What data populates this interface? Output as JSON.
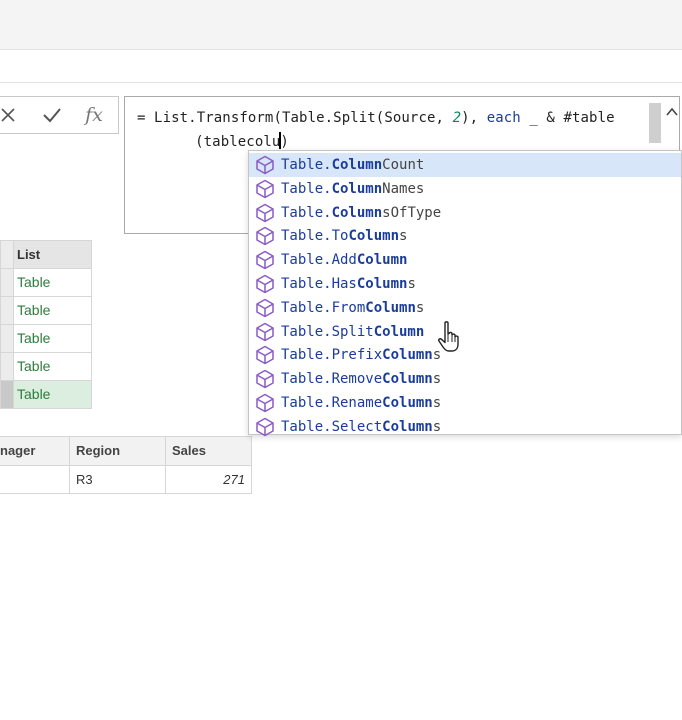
{
  "formula_bar": {
    "buttons": [
      {
        "name": "cancel",
        "icon": "close-icon"
      },
      {
        "name": "commit",
        "icon": "check-icon"
      },
      {
        "name": "insert-function",
        "label": "fx"
      }
    ],
    "line1_prefix": "= List.Transform(Table.Split(Source, ",
    "line1_num": "2",
    "line1_mid": "), ",
    "line1_kw": "each",
    "line1_suffix": " _ & #table",
    "line2_before_caret": "(tablecolu",
    "line2_after_caret": ")"
  },
  "list_grid": {
    "header": "List",
    "rows": [
      "Table",
      "Table",
      "Table",
      "Table",
      "Table"
    ],
    "selected_row": 4
  },
  "detail_table": {
    "headers": [
      "nager",
      "Region",
      "Sales"
    ],
    "rows": [
      [
        "",
        "R3",
        "271"
      ]
    ]
  },
  "autocomplete": {
    "prefix": "Table.",
    "items": [
      {
        "pre": "Table.",
        "parts": [
          [
            "",
            "Column",
            "Count"
          ]
        ]
      },
      {
        "pre": "Table.",
        "parts": [
          [
            "",
            "Column",
            "Names"
          ]
        ]
      },
      {
        "pre": "Table.",
        "parts": [
          [
            "",
            "Column",
            "sOfType"
          ]
        ]
      },
      {
        "pre": "Table.",
        "parts": [
          [
            "To",
            "Column",
            "s"
          ]
        ]
      },
      {
        "pre": "Table.",
        "parts": [
          [
            "Add",
            "Column",
            ""
          ]
        ]
      },
      {
        "pre": "Table.",
        "parts": [
          [
            "Has",
            "Column",
            "s"
          ]
        ]
      },
      {
        "pre": "Table.",
        "parts": [
          [
            "From",
            "Column",
            "s"
          ]
        ]
      },
      {
        "pre": "Table.",
        "parts": [
          [
            "Split",
            "Column",
            ""
          ]
        ]
      },
      {
        "pre": "Table.",
        "parts": [
          [
            "Prefix",
            "Column",
            "s"
          ]
        ]
      },
      {
        "pre": "Table.",
        "parts": [
          [
            "Remove",
            "Column",
            "s"
          ]
        ]
      },
      {
        "pre": "Table.",
        "parts": [
          [
            "Rename",
            "Column",
            "s"
          ]
        ]
      },
      {
        "pre": "Table.",
        "parts": [
          [
            "Select",
            "Column",
            "s"
          ]
        ]
      }
    ],
    "active_index": 0,
    "icon": "function-cube-icon"
  },
  "colors": {
    "keyword": "#1a3c9c",
    "number": "#098658",
    "list_value": "#2e7c3d",
    "active_item": "#d7e6f8",
    "icon_purple": "#8a5cc4"
  }
}
